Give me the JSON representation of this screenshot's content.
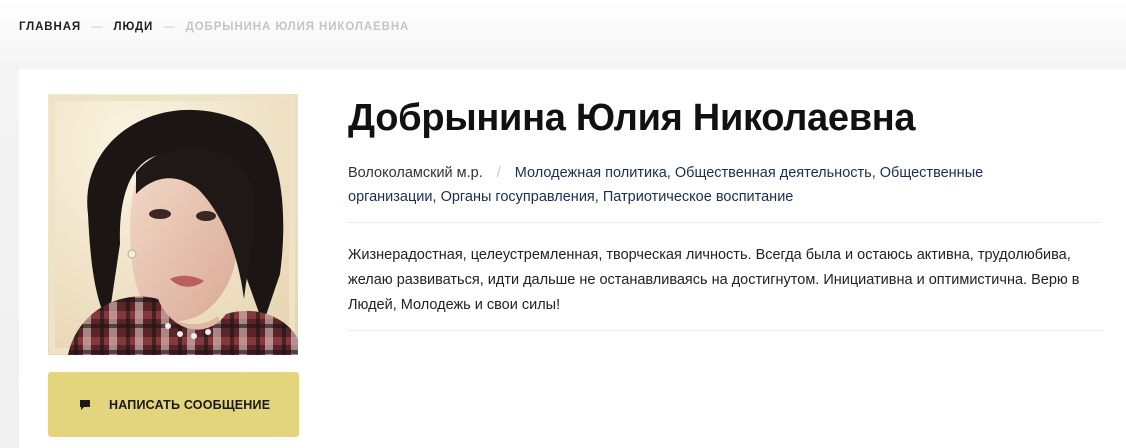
{
  "breadcrumb": {
    "home": "ГЛАВНАЯ",
    "people": "ЛЮДИ",
    "current": "ДОБРЫНИНА ЮЛИЯ НИКОЛАЕВНА",
    "separator": "—"
  },
  "profile": {
    "name": "Добрынина Юлия Николаевна",
    "region": "Волоколамский м.р.",
    "region_separator": "/",
    "tags": [
      "Молодежная политика",
      "Общественная деятельность",
      "Общественные организации",
      "Органы госуправления",
      "Патриотическое воспитание"
    ],
    "bio": "Жизнерадостная, целеустремленная, творческая личность. Всегда была и остаюсь активна, трудолюбива, желаю развиваться, идти дальше не останавливаясь на достигнутом. Инициативна и оптимистична. Верю в Людей, Молодежь и свои силы!",
    "photo_icon": "person-photo",
    "message_button": {
      "label": "НАПИСАТЬ СООБЩЕНИЕ",
      "icon": "speech-bubble-icon"
    }
  },
  "colors": {
    "button": "#e3d47e",
    "tag_link": "#1c2e4f",
    "breadcrumb_current": "#c5c5c5"
  }
}
